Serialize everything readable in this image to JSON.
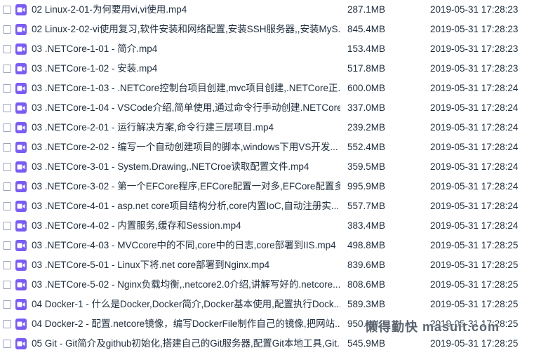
{
  "files": [
    {
      "name": "02 Linux-2-01-为何要用vi,vi使用.mp4",
      "size": "287.1MB",
      "date": "2019-05-31 17:28:23"
    },
    {
      "name": "02 Linux-2-02-vi使用复习,软件安装和网络配置,安装SSH服务器,,安装MyS...",
      "size": "845.4MB",
      "date": "2019-05-31 17:28:23"
    },
    {
      "name": "03 .NETCore-1-01 - 简介.mp4",
      "size": "153.4MB",
      "date": "2019-05-31 17:28:23"
    },
    {
      "name": "03 .NETCore-1-02 - 安装.mp4",
      "size": "517.8MB",
      "date": "2019-05-31 17:28:23"
    },
    {
      "name": "03 .NETCore-1-03 - .NETCore控制台项目创建,mvc项目创建,.NETCore正...",
      "size": "600.0MB",
      "date": "2019-05-31 17:28:24"
    },
    {
      "name": "03 .NETCore-1-04 - VSCode介绍,简单使用,通过命令行手动创建.NETCore...",
      "size": "337.0MB",
      "date": "2019-05-31 17:28:24"
    },
    {
      "name": "03 .NETCore-2-01 - 运行解决方案,命令行建三层项目.mp4",
      "size": "239.2MB",
      "date": "2019-05-31 17:28:24"
    },
    {
      "name": "03 .NETCore-2-02 - 编写一个自动创建项目的脚本,windows下用VS开发...",
      "size": "552.4MB",
      "date": "2019-05-31 17:28:24"
    },
    {
      "name": "03 .NETCore-3-01 - System.Drawing,.NETCroe读取配置文件.mp4",
      "size": "359.5MB",
      "date": "2019-05-31 17:28:24"
    },
    {
      "name": "03 .NETCore-3-02 - 第一个EFCore程序,EFCore配置一对多,EFCore配置多...",
      "size": "995.9MB",
      "date": "2019-05-31 17:28:24"
    },
    {
      "name": "03 .NETCore-4-01 - asp.net core项目结构分析,core内置IoC,自动注册实...",
      "size": "557.7MB",
      "date": "2019-05-31 17:28:24"
    },
    {
      "name": "03 .NETCore-4-02 - 内置服务,缓存和Session.mp4",
      "size": "383.4MB",
      "date": "2019-05-31 17:28:24"
    },
    {
      "name": "03 .NETCore-4-03 - MVCcore中的不同,core中的日志,core部署到IIS.mp4",
      "size": "498.8MB",
      "date": "2019-05-31 17:28:25"
    },
    {
      "name": "03 .NETCore-5-01 - Linux下将.net core部署到Nginx.mp4",
      "size": "839.6MB",
      "date": "2019-05-31 17:28:25"
    },
    {
      "name": "03 .NETCore-5-02 - Nginx负载均衡,.netcore2.0介绍,讲解写好的.netcore...",
      "size": "808.6MB",
      "date": "2019-05-31 17:28:25"
    },
    {
      "name": "04 Docker-1 - 什么是Docker,Docker简介,Docker基本使用,配置执行Dock...",
      "size": "589.3MB",
      "date": "2019-05-31 17:28:25"
    },
    {
      "name": "04 Docker-2 - 配置.netcore镜像，编写DockerFile制作自己的镜像,把网站...",
      "size": "950.0MB",
      "date": "2019-05-31 17:28:25"
    },
    {
      "name": "05 Git - Git简介及github初始化,搭建自己的Git服务器,配置Git本地工具,Git...",
      "size": "545.9MB",
      "date": "2019-05-31 17:28:25"
    }
  ],
  "watermark": "懒得勤快 masuit.com",
  "colors": {
    "icon": "#7b5cf2",
    "text": "#1f2d3d",
    "checkbox_border": "#9aa6b8"
  },
  "icons": {
    "checkbox": "checkbox-icon",
    "file": "video-file-icon"
  }
}
